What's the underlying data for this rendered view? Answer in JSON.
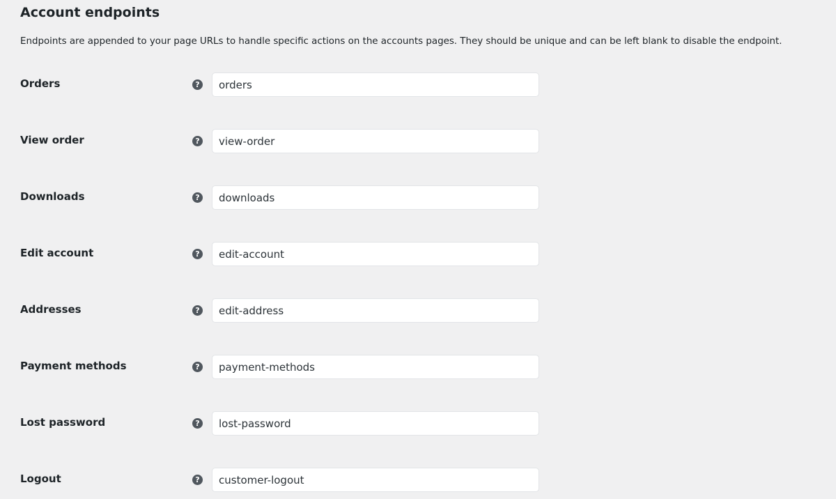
{
  "section": {
    "title": "Account endpoints",
    "description": "Endpoints are appended to your page URLs to handle specific actions on the accounts pages. They should be unique and can be left blank to disable the endpoint."
  },
  "help_icon_glyph": "?",
  "endpoints": [
    {
      "key": "orders",
      "label": "Orders",
      "value": "orders"
    },
    {
      "key": "view-order",
      "label": "View order",
      "value": "view-order"
    },
    {
      "key": "downloads",
      "label": "Downloads",
      "value": "downloads"
    },
    {
      "key": "edit-account",
      "label": "Edit account",
      "value": "edit-account"
    },
    {
      "key": "addresses",
      "label": "Addresses",
      "value": "edit-address"
    },
    {
      "key": "payment-methods",
      "label": "Payment methods",
      "value": "payment-methods"
    },
    {
      "key": "lost-password",
      "label": "Lost password",
      "value": "lost-password"
    },
    {
      "key": "logout",
      "label": "Logout",
      "value": "customer-logout"
    }
  ]
}
